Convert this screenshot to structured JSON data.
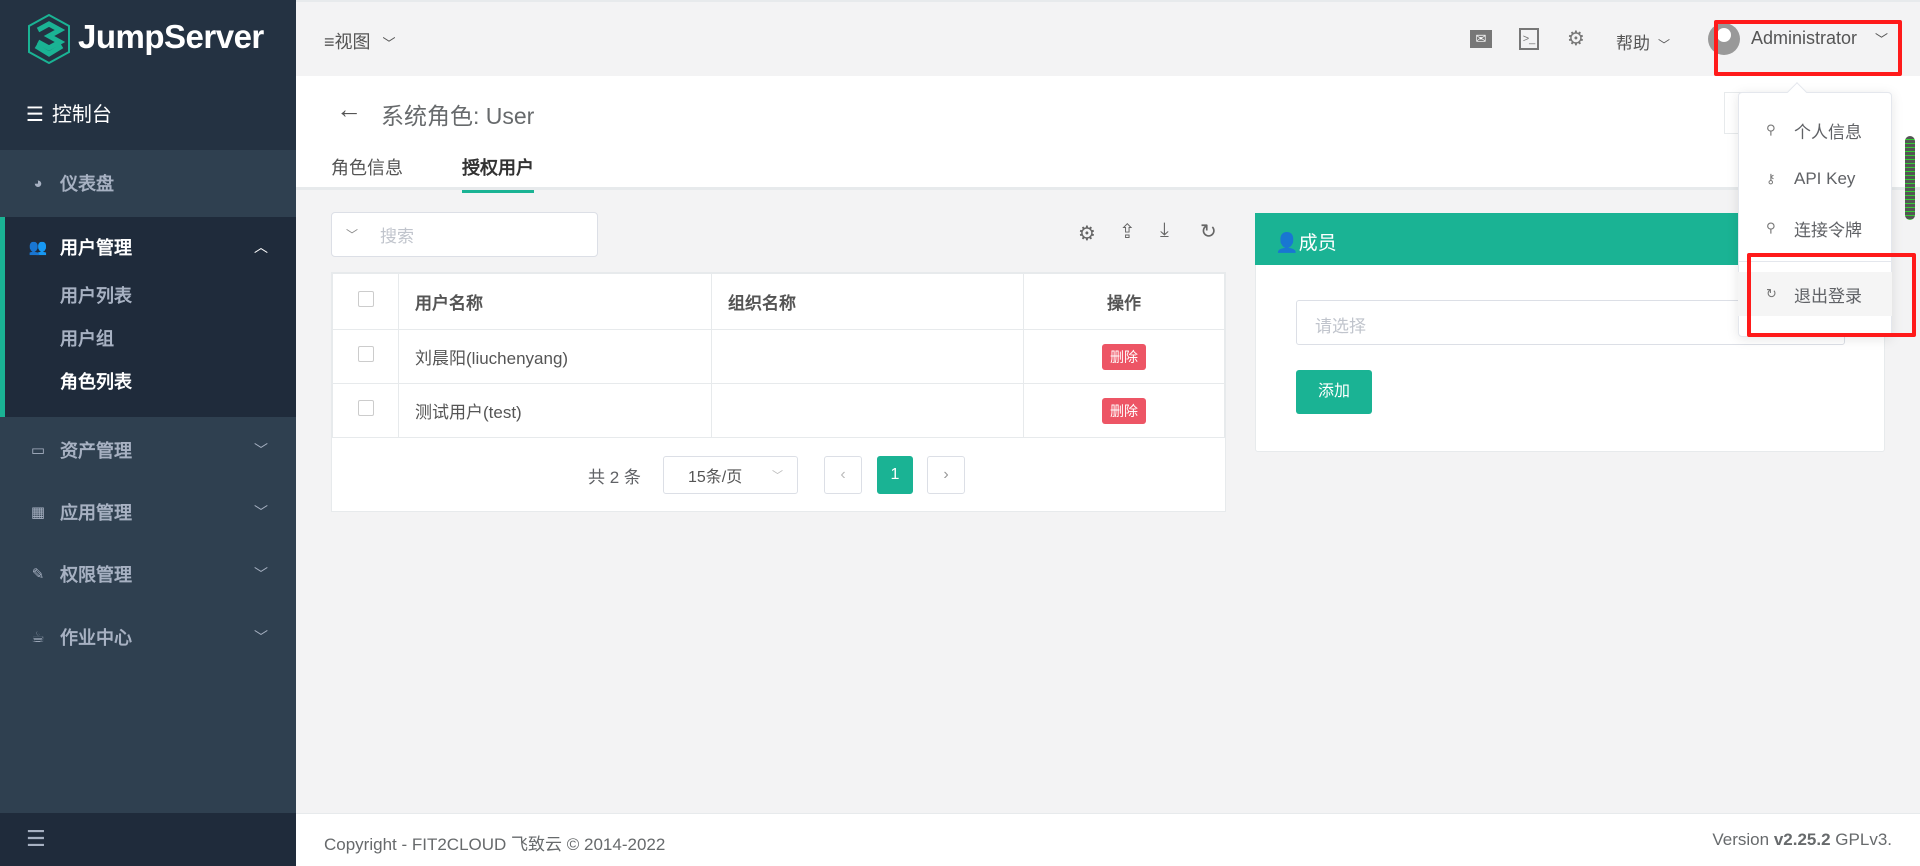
{
  "app": {
    "logo": "JumpServer",
    "console": "控制台"
  },
  "sidebar": {
    "dashboard": "仪表盘",
    "user_mgmt": "用户管理",
    "user_sub": [
      "用户列表",
      "用户组",
      "角色列表"
    ],
    "asset_mgmt": "资产管理",
    "app_mgmt": "应用管理",
    "perm_mgmt": "权限管理",
    "job_center": "作业中心"
  },
  "header": {
    "view": "视图",
    "help": "帮助",
    "user": "Administrator"
  },
  "page": {
    "title": "系统角色: User",
    "tabs": [
      "角色信息",
      "授权用户"
    ],
    "active_tab": 1
  },
  "search": {
    "placeholder": "搜索"
  },
  "table": {
    "columns": [
      "用户名称",
      "组织名称",
      "操作"
    ],
    "rows": [
      {
        "name": "刘晨阳(liuchenyang)",
        "org": "",
        "action": "删除"
      },
      {
        "name": "测试用户(test)",
        "org": "",
        "action": "删除"
      }
    ]
  },
  "pagination": {
    "total": "共 2 条",
    "page_size": "15条/页",
    "current": "1"
  },
  "members": {
    "title": "成员",
    "placeholder": "请选择",
    "add": "添加"
  },
  "user_menu": {
    "items": [
      "个人信息",
      "API Key",
      "连接令牌",
      "退出登录"
    ]
  },
  "footer": {
    "copyright": "Copyright - FIT2CLOUD 飞致云 © 2014-2022",
    "version_prefix": "Version",
    "version": "v2.25.2",
    "license": "GPLv3."
  },
  "colors": {
    "accent": "#1ab394",
    "danger": "#ed5565",
    "sidebar": "#2f4050",
    "highlight": "#ff1a1a"
  }
}
